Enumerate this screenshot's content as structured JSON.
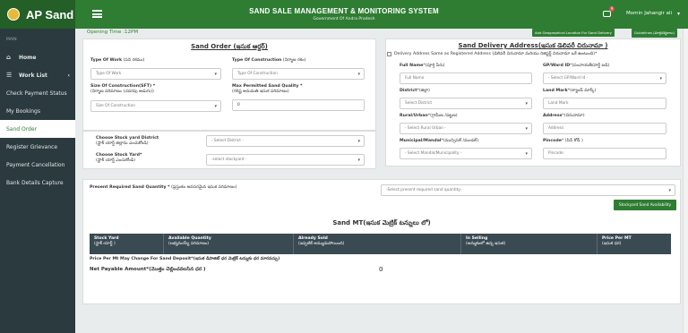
{
  "app": {
    "name": "AP Sand",
    "title": "SAND SALE MANAGEMENT & MONITORING SYSTEM",
    "subtitle": "Government Of Andra Pradesh"
  },
  "header": {
    "notification_count": "9",
    "user": "Momin Jahangir ali",
    "user_caret": "▾"
  },
  "sidebar": {
    "section_label": "MAIN",
    "items": [
      {
        "label": "Home",
        "icon": "⌂"
      },
      {
        "label": "Work List",
        "icon": "☰",
        "chevron": "‹"
      },
      {
        "label": "Check Payment Status"
      },
      {
        "label": "My Bookings"
      },
      {
        "label": "Sand Order"
      },
      {
        "label": "Register Grievance"
      },
      {
        "label": "Payment Cancellation"
      },
      {
        "label": "Bank Details Capture"
      }
    ]
  },
  "opening_time": "Opening Time :12PM",
  "top_buttons": {
    "geo": "Add Geographical Location For Sand Delivery",
    "guidelines": "Guidelines (మార్గదర్శకాలు)"
  },
  "sand_order": {
    "title": "Sand Order (ఇసుక ఆర్డర్)",
    "type_of_work": {
      "label": "Type Of Work",
      "label_te": "(పని రకము)",
      "placeholder": "Type Of Work"
    },
    "type_of_construction": {
      "label": "Type Of Construction",
      "label_te": "(నిర్మాణ రకం)",
      "placeholder": "Type Of Construction"
    },
    "size_of_construction": {
      "label": "Size Of Construction(SFT) *",
      "label_te": "(నిర్మాణ పరిమాణం (చదరపు అడుగు))",
      "placeholder": "Size Of Construction"
    },
    "max_quantity": {
      "label": "Max Permitted Sand Quality *",
      "label_te": "(గరిష్ట అనుమతి ఇసుక పరిమాణం)",
      "value": "0"
    }
  },
  "stockyard": {
    "district": {
      "label": "Choose Stock yard District",
      "label_te": "(స్టాక్ యార్డ్ జిల్లాను ఎంచుకోండి)",
      "placeholder": "- Select District -"
    },
    "stockyard": {
      "label": "Choose Stock Yard*",
      "label_te": "(స్టాక్ యార్డ్ ఎంచుకోండి)",
      "placeholder": "-select stockyard -"
    }
  },
  "delivery": {
    "title": "Sand Delivery Address(ఇసుక డెలివరీ చిరునామా )",
    "same_as_registered": "Delivery Address Same as Registered Address (డెలివరీ చిరునామా మరియు రిజిస్టర్డ్ చిరునామా ఒకే ఉంటుంది)*",
    "full_name": {
      "label": "Full Name",
      "label_te": "*(పూర్తి పేరు)",
      "placeholder": "Full Name"
    },
    "gp_ward": {
      "label": "GP/Ward ID",
      "label_te": "*(పంచాయతీ/వార్డ్ ఐడి)",
      "placeholder": "- Select GP/Ward Id -"
    },
    "district": {
      "label": "District",
      "label_te": "*(జిల్లా)",
      "placeholder": "Select District"
    },
    "land_mark": {
      "label": "Land Mark",
      "label_te": "*(ల్యాండ్ మార్క్)",
      "placeholder": "Land Mark"
    },
    "rural_urban": {
      "label": "Rural/Urban",
      "label_te": "*(గ్రామీణ /పట్టణ)",
      "placeholder": "- Select Rural Urban -"
    },
    "address": {
      "label": "Address",
      "label_te": "*(చిరునామా)",
      "placeholder": "Address"
    },
    "mandal": {
      "label": "Municipal/Mandal",
      "label_te": "*(మున్సిపల్ /మండల్)",
      "placeholder": "- Select Mandal/Municipality -"
    },
    "pincode": {
      "label": "Pincode",
      "label_te": "* (పిన్ కోడ్ )",
      "placeholder": "Pincode"
    }
  },
  "quantity": {
    "label": "Present Required Sand Quantity *",
    "label_te": "(ప్రస్తుతం అవసరమైన ఇసుక పరిమాణం)",
    "placeholder": "-Select present required sand quantity-",
    "stock_button": "Stockyard Sand Availability"
  },
  "sand_mt": {
    "title": "Sand MT(ఇసుక మెట్రిక్ టన్నులు లో)",
    "columns": [
      {
        "en": "Stock Yard",
        "te": "(స్టాక్ యార్డ్ )"
      },
      {
        "en": "Available Quantity",
        "te": "(లభ్యమయ్యే పరిమాణం)"
      },
      {
        "en": "Already Sold",
        "te": "(ఇప్పటికే అమ్ముడుపోయింది)"
      },
      {
        "en": "In Selling",
        "te": "(అమ్మకంలో ఉన్న ఇసుక)"
      },
      {
        "en": "Price Per MT",
        "te": "(ఇసుక ధర)"
      }
    ],
    "price_note": "Price Per Mt May Change For Sand Deposit*(ఇసుక డిపాజిట్ ధర మెట్రిక్ టన్నుకు ధర మారవచ్చు)",
    "net_payable_label": "Net Payable Amount*(మొత్తం చెల్లించవలసిన ధర )",
    "net_payable_value": "0"
  },
  "icons": {
    "bell": "bell-icon",
    "hamburger": "hamburger-icon",
    "home": "home-icon",
    "list": "list-icon"
  },
  "colors": {
    "brand": "#2e7d32",
    "sidebar": "#2a3a3f",
    "table_header": "#3a4a52"
  }
}
